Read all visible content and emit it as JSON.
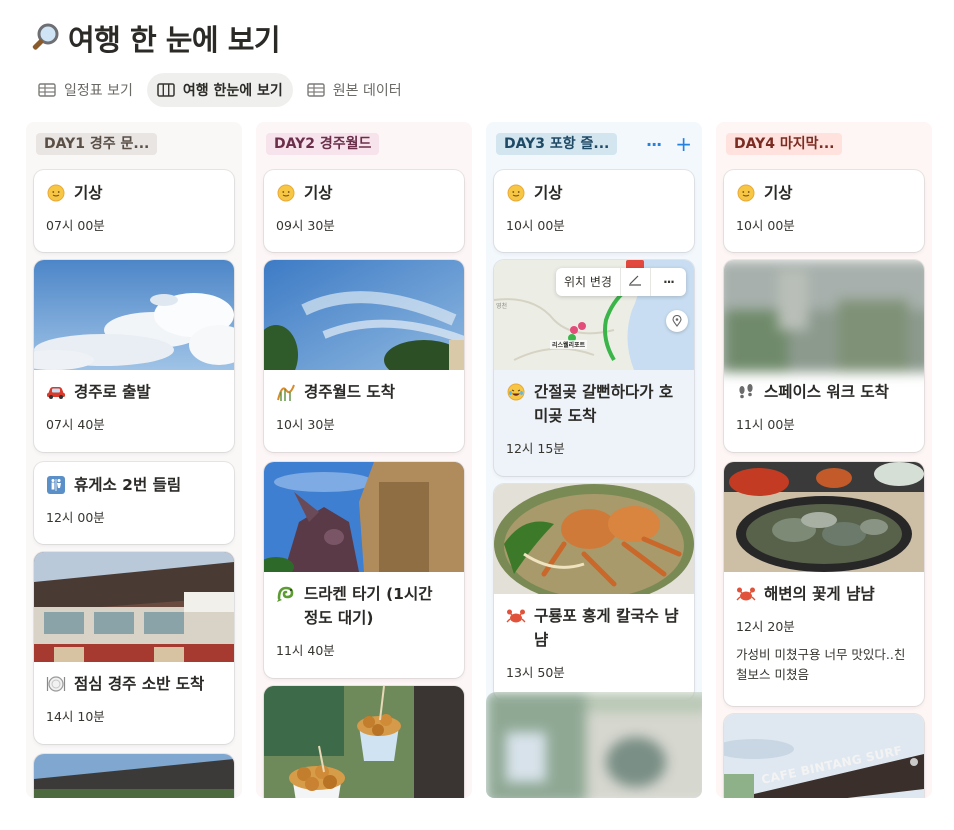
{
  "page": {
    "title": "여행 한 눈에 보기",
    "title_icon": "magnifier-icon"
  },
  "tabs": [
    {
      "label": "일정표 보기",
      "icon": "table-icon",
      "active": false
    },
    {
      "label": "여행 한눈에 보기",
      "icon": "board-icon",
      "active": true
    },
    {
      "label": "원본 데이터",
      "icon": "table-icon",
      "active": false
    }
  ],
  "columns": [
    {
      "tag": "DAY1 경주 문...",
      "cards": [
        {
          "emoji": "sun-face-icon",
          "title": "기상",
          "time": "07시 00분"
        },
        {
          "emoji": "car-icon",
          "title": "경주로 출발",
          "time": "07시 40분"
        },
        {
          "emoji": "restroom-icon",
          "title": "휴게소 2번 들림",
          "time": "12시 00분"
        },
        {
          "emoji": "plate-icon",
          "title": "점심 경주 소반 도착",
          "time": "14시 10분"
        }
      ]
    },
    {
      "tag": "DAY2 경주월드",
      "cards": [
        {
          "emoji": "sun-face-icon",
          "title": "기상",
          "time": "09시 30분"
        },
        {
          "emoji": "rollercoaster-icon",
          "title": "경주월드 도착",
          "time": "10시 30분"
        },
        {
          "emoji": "dragon-icon",
          "title": "드라켄 타기 (1시간 정도 대기)",
          "time": "11시 40분"
        }
      ]
    },
    {
      "tag": "DAY3 포항 즐...",
      "actions": {
        "more": "···",
        "add": "+"
      },
      "cards": [
        {
          "emoji": "sun-face-icon",
          "title": "기상",
          "time": "10시 00분"
        },
        {
          "emoji": "laugh-icon",
          "title": "간절곶 갈뻔하다가 호미곶 도착",
          "time": "12시 15분",
          "map_toolbar": {
            "label": "위치 변경",
            "more": "···"
          },
          "map_label": "리스웰리포트"
        },
        {
          "emoji": "crab-icon",
          "title": "구룡포 홍게 칼국수 냠냠",
          "time": "13시 50분"
        }
      ]
    },
    {
      "tag": "DAY4 마지막...",
      "cards": [
        {
          "emoji": "sun-face-icon",
          "title": "기상",
          "time": "10시 00분"
        },
        {
          "emoji": "footprints-icon",
          "title": "스페이스 워크 도착",
          "time": "11시 00분"
        },
        {
          "emoji": "crab-icon",
          "title": "해변의 꽃게 냠냠",
          "time": "12시 20분",
          "note": "가성비 미쳤구용 너무 맛있다..친철보스 미쳤음"
        }
      ],
      "photo_sign": "CAFE BINTANG SURF"
    }
  ],
  "colors": {
    "col1_bg": "#f9f8f7",
    "col1_tag": "#e9e5e3",
    "col1_tag_text": "#5a4f46",
    "col2_bg": "#fdf6f6",
    "col2_tag": "#f6e3eb",
    "col2_tag_text": "#6b2f4a",
    "col3_bg": "#f3f8fd",
    "col3_tag": "#d3e5ef",
    "col3_tag_text": "#1f4a66",
    "col4_bg": "#fdf6f5",
    "col4_tag": "#ffe2dd",
    "col4_tag_text": "#7a2b22",
    "accent": "#2383e2"
  }
}
